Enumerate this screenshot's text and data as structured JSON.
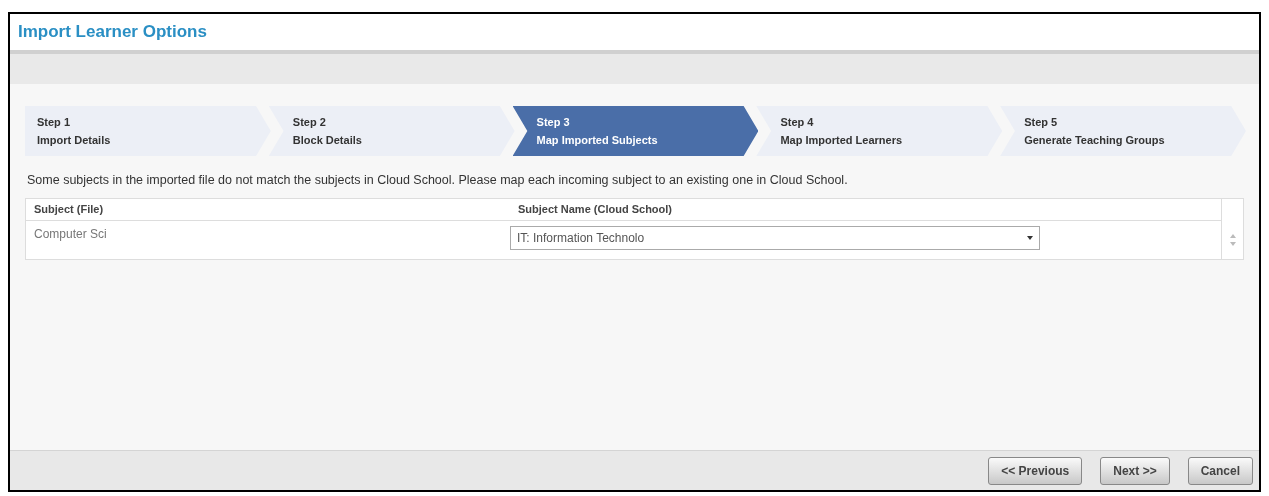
{
  "window": {
    "title": "Import Learner Options"
  },
  "steps": [
    {
      "number": "Step 1",
      "label": "Import Details",
      "selected": false
    },
    {
      "number": "Step 2",
      "label": "Block Details",
      "selected": false
    },
    {
      "number": "Step 3",
      "label": "Map Imported Subjects",
      "selected": true
    },
    {
      "number": "Step 4",
      "label": "Map Imported Learners",
      "selected": false
    },
    {
      "number": "Step 5",
      "label": "Generate Teaching Groups",
      "selected": false
    }
  ],
  "message": "Some subjects in the imported file do not match the subjects in Cloud School. Please map each incoming subject to an existing one in Cloud School.",
  "table": {
    "columns": [
      "Subject (File)",
      "Subject Name (Cloud School)"
    ],
    "rows": [
      {
        "subject": "Computer Sci",
        "mapping": "IT: Information Technolo"
      }
    ]
  },
  "buttons": [
    "<< Previous",
    "Next >>",
    "Cancel"
  ]
}
